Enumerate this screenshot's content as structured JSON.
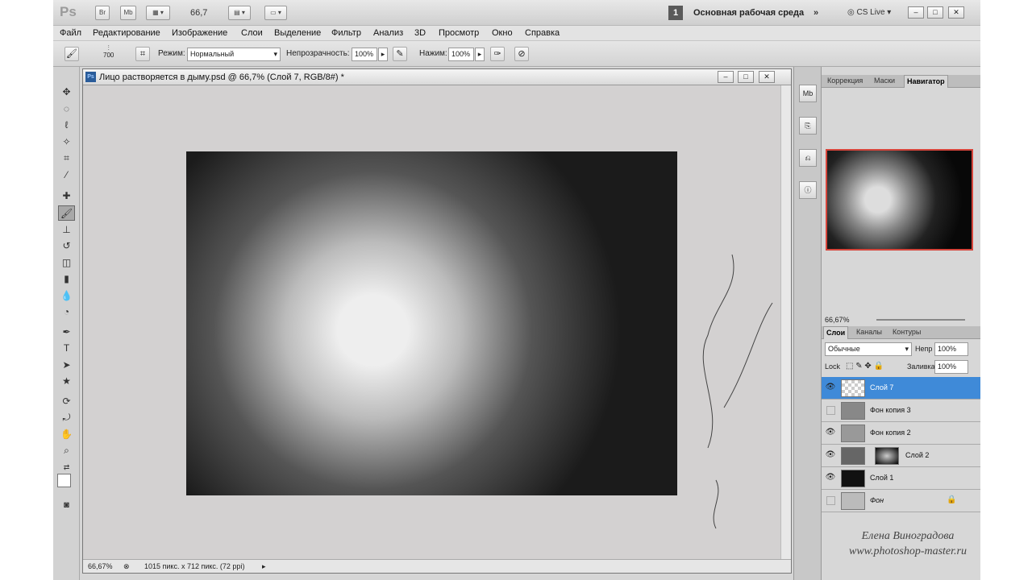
{
  "appbar": {
    "logo": "Ps",
    "bridge_btn": "Br",
    "minibridge_btn": "Mb",
    "zoom": "66,7",
    "workspace_num": "1",
    "workspace": "Основная рабочая среда",
    "cslive": "CS Live"
  },
  "menu": [
    "Файл",
    "Редактирование",
    "Изображение",
    "Слои",
    "Выделение",
    "Фильтр",
    "Анализ",
    "3D",
    "Просмотр",
    "Окно",
    "Справка"
  ],
  "options": {
    "brush_size": "700",
    "mode_label": "Режим:",
    "mode_value": "Нормальный",
    "opacity_label": "Непрозрачность:",
    "opacity_value": "100%",
    "flow_label": "Нажим:",
    "flow_value": "100%"
  },
  "document": {
    "title": "Лицо растворяется в дыму.psd @ 66,7% (Слой 7, RGB/8#) *",
    "zoom": "66,67%",
    "info": "1015 пикс. x 712 пикс. (72 ppi)"
  },
  "panels": {
    "top_tabs": [
      "Коррекция",
      "Маски",
      "Навигатор"
    ],
    "nav_zoom": "66,67%",
    "layer_tabs": [
      "Слои",
      "Каналы",
      "Контуры"
    ],
    "blend": "Обычные",
    "opacity_label": "Непр",
    "opacity": "100%",
    "lock_label": "Lock",
    "fill_label": "Заливка",
    "fill": "100%",
    "layers": [
      "Слой 7",
      "Фон копия 3",
      "Фон копия 2",
      "Слой 2",
      "Слой 1",
      "Фон"
    ]
  },
  "signature": {
    "line1": "Елена Виноградова",
    "line2": "www.photoshop-master.ru"
  }
}
